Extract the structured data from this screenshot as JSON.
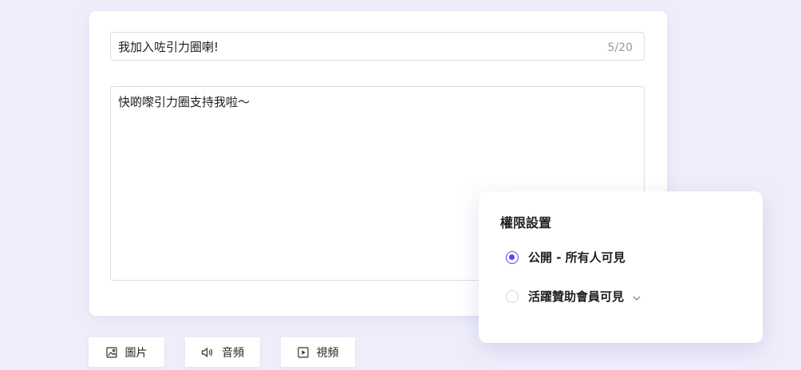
{
  "editor": {
    "title_value": "我加入咗引力圈喇!",
    "title_char_count": "5/20",
    "body_value": "快啲嚟引力圈支持我啦～"
  },
  "media_buttons": {
    "image": {
      "label": "圖片",
      "icon": "image-icon"
    },
    "audio": {
      "label": "音頻",
      "icon": "speaker-icon"
    },
    "video": {
      "label": "視頻",
      "icon": "video-play-icon"
    }
  },
  "permissions": {
    "title": "權限設置",
    "options": [
      {
        "label": "公開 - 所有人可見",
        "selected": true
      },
      {
        "label": "活躍贊助會員可見",
        "selected": false,
        "has_dropdown": true
      }
    ]
  },
  "colors": {
    "accent": "#5b45e6",
    "background": "#eeeefb"
  }
}
